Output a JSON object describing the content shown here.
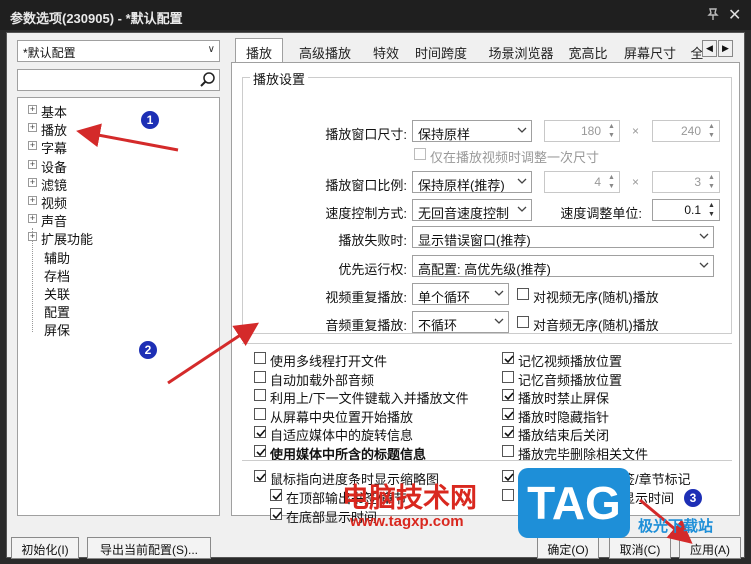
{
  "window": {
    "title": "参数选项(230905) - *默认配置",
    "close_glyph": "✕"
  },
  "left": {
    "preset_value": "*默认配置",
    "tree": [
      {
        "label": "基本",
        "expandable": true
      },
      {
        "label": "播放",
        "expandable": true
      },
      {
        "label": "字幕",
        "expandable": true
      },
      {
        "label": "设备",
        "expandable": true
      },
      {
        "label": "滤镜",
        "expandable": true
      },
      {
        "label": "视频",
        "expandable": true
      },
      {
        "label": "声音",
        "expandable": true
      },
      {
        "label": "扩展功能",
        "expandable": true
      },
      {
        "label": "辅助",
        "expandable": false
      },
      {
        "label": "存档",
        "expandable": false
      },
      {
        "label": "关联",
        "expandable": false
      },
      {
        "label": "配置",
        "expandable": false
      },
      {
        "label": "屏保",
        "expandable": false
      }
    ],
    "expand_glyph": "+"
  },
  "tabs": [
    "播放",
    "高级播放",
    "特效",
    "时间跨度",
    "场景浏览器",
    "宽高比",
    "屏幕尺寸",
    "全"
  ],
  "active_tab": "播放",
  "playback": {
    "group_title": "播放设置",
    "window_size_label": "播放窗口尺寸:",
    "window_size_value": "保持原样",
    "width": "180",
    "height": "240",
    "times": "×",
    "only_once_label": "仅在播放视频时调整一次尺寸",
    "ratio_label": "播放窗口比例:",
    "ratio_value": "保持原样(推荐)",
    "ratio_w": "4",
    "ratio_h": "3",
    "speed_mode_label": "速度控制方式:",
    "speed_mode_value": "无回音速度控制",
    "speed_unit_label": "速度调整单位:",
    "speed_unit_value": "0.1",
    "fail_label": "播放失败时:",
    "fail_value": "显示错误窗口(推荐)",
    "priority_label": "优先运行权:",
    "priority_value": "高配置: 高优先级(推荐)",
    "video_repeat_label": "视频重复播放:",
    "video_repeat_value": "单个循环",
    "video_shuffle_label": "对视频无序(随机)播放",
    "audio_repeat_label": "音频重复播放:",
    "audio_repeat_value": "不循环",
    "audio_shuffle_label": "对音频无序(随机)播放"
  },
  "options_left": [
    {
      "label": "使用多线程打开文件",
      "checked": false,
      "bold": false
    },
    {
      "label": "自动加载外部音频",
      "checked": false,
      "bold": false
    },
    {
      "label": "利用上/下一文件键载入并播放文件",
      "checked": false,
      "bold": false
    },
    {
      "label": "从屏幕中央位置开始播放",
      "checked": false,
      "bold": false
    },
    {
      "label": "自适应媒体中的旋转信息",
      "checked": true,
      "bold": false
    },
    {
      "label": "使用媒体中所含的标题信息",
      "checked": true,
      "bold": true
    }
  ],
  "options_right": [
    {
      "label": "记忆视频播放位置",
      "checked": true
    },
    {
      "label": "记忆音频播放位置",
      "checked": false
    },
    {
      "label": "播放时禁止屏保",
      "checked": true
    },
    {
      "label": "播放时隐藏指针",
      "checked": true
    },
    {
      "label": "播放结束后关闭",
      "checked": true
    },
    {
      "label": "播放完毕删除相关文件",
      "checked": false
    }
  ],
  "thumbnail": {
    "show_thumb": "鼠标指向进度条时显示缩略图",
    "top_bookmark": "在顶部输出书签/章节",
    "bottom_time": "在底部显示时间",
    "show_marks": "在进度条上显示书签/章节标记",
    "show_time": "鼠标在进度条上时显示时间"
  },
  "footer": {
    "init": "初始化(I)",
    "export": "导出当前配置(S)...",
    "ok": "确定(O)",
    "cancel": "取消(C)",
    "apply": "应用(A)"
  },
  "annotations": {
    "badge1": "1",
    "badge2": "2",
    "badge3": "3",
    "arrow_color": "#d42a2a"
  },
  "watermark": {
    "site_name": "电脑技术网",
    "site_url": "www.tagxp.com",
    "logo_text": "TAG",
    "logo_sub": "极光下载站"
  }
}
